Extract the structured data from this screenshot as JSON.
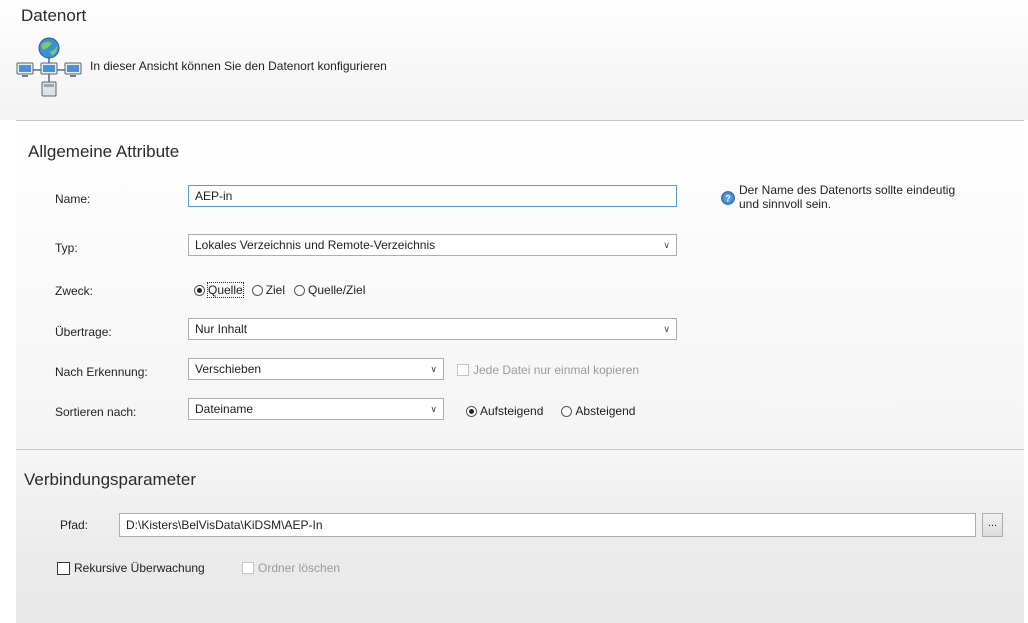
{
  "header": {
    "title": "Datenort",
    "description": "In dieser Ansicht können Sie den Datenort konfigurieren",
    "icon": "network-computers-icon"
  },
  "general": {
    "section_title": "Allgemeine Attribute",
    "name": {
      "label": "Name:",
      "value": "AEP-in"
    },
    "info_text_line1": "Der Name des Datenorts sollte eindeutig",
    "info_text_line2": "und sinnvoll sein.",
    "type": {
      "label": "Typ:",
      "value": "Lokales Verzeichnis und Remote-Verzeichnis"
    },
    "purpose": {
      "label": "Zweck:",
      "options": [
        "Quelle",
        "Ziel",
        "Quelle/Ziel"
      ],
      "selected": "Quelle"
    },
    "transfer": {
      "label": "Übertrage:",
      "value": "Nur Inhalt"
    },
    "after_detection": {
      "label": "Nach Erkennung:",
      "value": "Verschieben",
      "copy_once_label": "Jede Datei nur einmal kopieren",
      "copy_once_checked": false
    },
    "sort": {
      "label": "Sortieren nach:",
      "value": "Dateiname",
      "order_options": [
        "Aufsteigend",
        "Absteigend"
      ],
      "order_selected": "Aufsteigend"
    }
  },
  "connection": {
    "section_title": "Verbindungsparameter",
    "path": {
      "label": "Pfad:",
      "value": "D:\\Kisters\\BelVisData\\KiDSM\\AEP-In"
    },
    "browse_label": "...",
    "recursive_label": "Rekursive Überwachung",
    "recursive_checked": false,
    "delete_folder_label": "Ordner löschen",
    "delete_folder_checked": false
  },
  "colors": {
    "accent": "#5b9bd5",
    "info_icon": "#2f6fb9"
  }
}
